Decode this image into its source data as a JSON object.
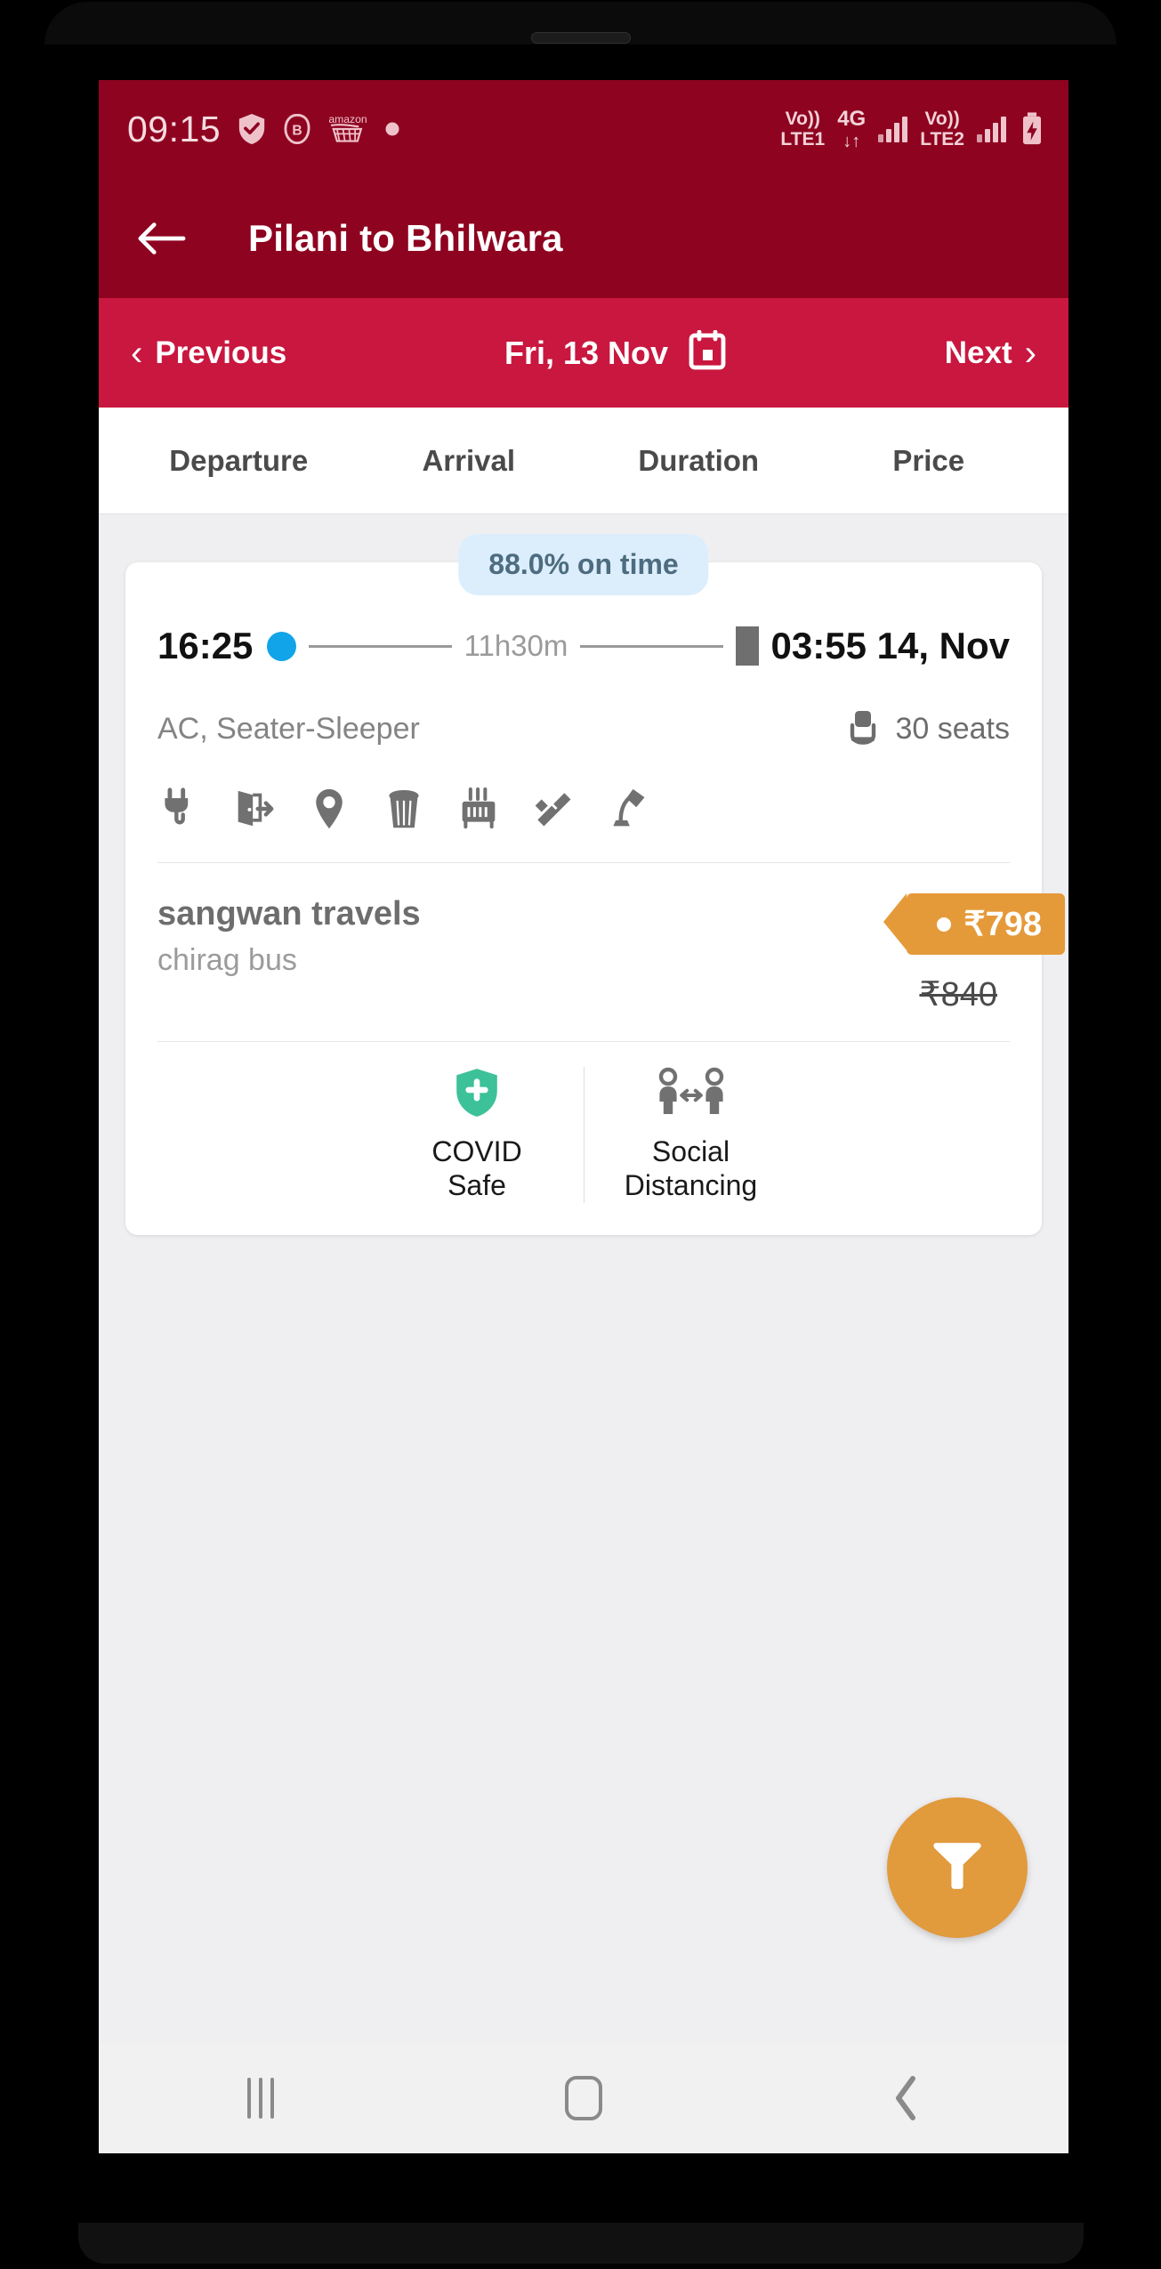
{
  "status_bar": {
    "clock": "09:15",
    "left_icons": [
      "shield-check-icon",
      "bhim-icon",
      "amazon-cart-icon",
      "dot-icon"
    ],
    "sim1": {
      "top": "Vo))",
      "bottom": "LTE1"
    },
    "network": {
      "type": "4G",
      "arrows": "↓↑"
    },
    "sim2": {
      "top": "Vo))",
      "bottom": "LTE2"
    },
    "battery": "charging"
  },
  "header": {
    "back_icon": "back-arrow-icon",
    "title": "Pilani to Bhilwara"
  },
  "date_bar": {
    "previous_label": "Previous",
    "previous_chevron": "‹",
    "date": "Fri, 13 Nov",
    "calendar_icon": "calendar-icon",
    "next_label": "Next",
    "next_chevron": "›"
  },
  "sort_tabs": [
    {
      "label": "Departure"
    },
    {
      "label": "Arrival"
    },
    {
      "label": "Duration"
    },
    {
      "label": "Price"
    }
  ],
  "bus_card": {
    "ontime_badge": "88.0% on time",
    "departure_time": "16:25",
    "duration": "11h30m",
    "arrival_time": "03:55 14, Nov",
    "bus_type": "AC, Seater-Sleeper",
    "seats_available": "30 seats",
    "seat_icon": "bus-seat-icon",
    "amenities": [
      "charging-point-icon",
      "emergency-exit-icon",
      "live-tracking-icon",
      "dustbin-icon",
      "heater-vent-icon",
      "blanket-icon",
      "reading-light-icon"
    ],
    "operator_name": "sangwan travels",
    "operator_sub": "chirag bus",
    "price": "₹798",
    "price_struck": "₹840",
    "badges": [
      {
        "icon": "covid-shield-icon",
        "line1": "COVID",
        "line2": "Safe"
      },
      {
        "icon": "social-distancing-icon",
        "line1": "Social",
        "line2": "Distancing"
      }
    ]
  },
  "fab": {
    "icon": "filter-funnel-icon"
  },
  "android_nav": {
    "recents": "recents-icon",
    "home": "home-icon",
    "back": "back-icon"
  },
  "colors": {
    "status_bar": "#8e0320",
    "title_bar": "#8e0320",
    "date_bar": "#c9173f",
    "accent_orange": "#e19a3c",
    "ontime_bg": "#dceefc",
    "covid_green": "#3cc198",
    "depart_dot": "#12a4e8"
  }
}
